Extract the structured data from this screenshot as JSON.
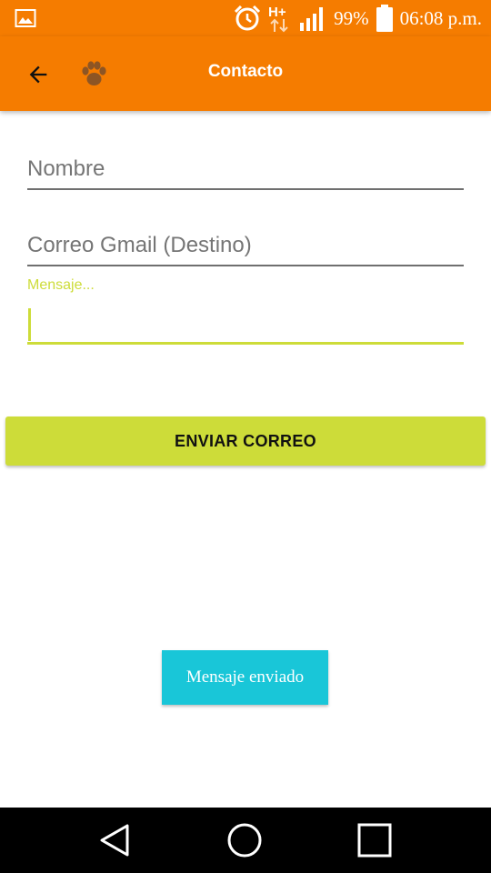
{
  "status_bar": {
    "battery": "99%",
    "time": "06:08 p.m.",
    "network": "H+",
    "icons": [
      "image-icon",
      "alarm-icon",
      "network-hplus-icon",
      "signal-icon",
      "battery-icon"
    ]
  },
  "app_bar": {
    "title": "Contacto",
    "icons": [
      "back-arrow-icon",
      "paw-icon"
    ]
  },
  "form": {
    "nombre_placeholder": "Nombre",
    "nombre_value": "",
    "correo_placeholder": "Correo Gmail (Destino)",
    "correo_value": "",
    "mensaje_label": "Mensaje...",
    "mensaje_value": "",
    "send_label": "ENVIAR CORREO"
  },
  "toast": {
    "text": "Mensaje enviado"
  },
  "nav_bar": {
    "icons": [
      "back-triangle-icon",
      "home-circle-icon",
      "recents-square-icon"
    ]
  },
  "colors": {
    "primary": "#f57c00",
    "accent": "#cddc39",
    "toast": "#19c6d8",
    "navbar": "#000000"
  }
}
